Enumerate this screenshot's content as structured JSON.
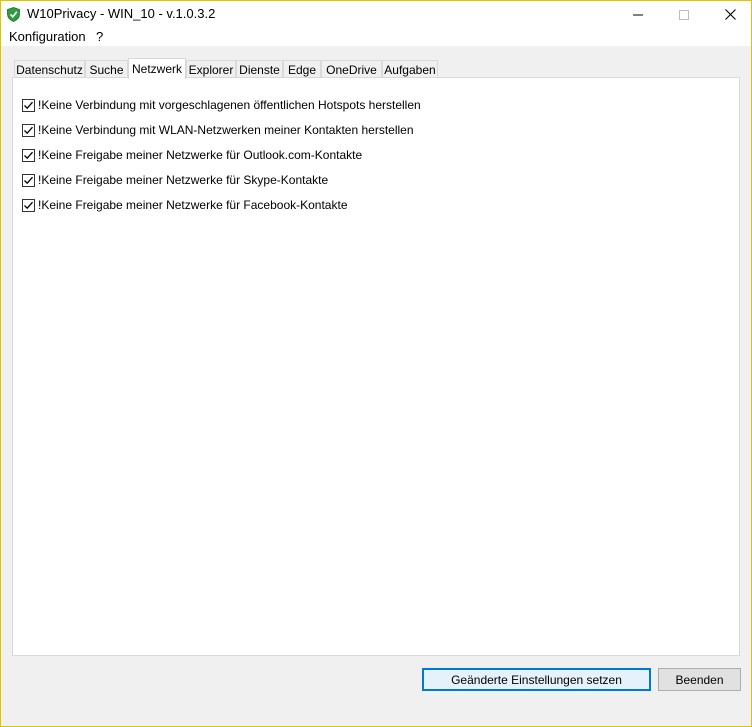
{
  "window": {
    "title": "W10Privacy - WIN_10 - v.1.0.3.2",
    "minimize_glyph": "—",
    "maximize_glyph": "☐",
    "close_glyph": "✕"
  },
  "menu": {
    "items": [
      "Konfiguration",
      "?"
    ]
  },
  "tabs": [
    {
      "label": "Datenschutz"
    },
    {
      "label": "Suche"
    },
    {
      "label": "Netzwerk",
      "active": true
    },
    {
      "label": "Explorer"
    },
    {
      "label": "Dienste"
    },
    {
      "label": "Edge"
    },
    {
      "label": "OneDrive"
    },
    {
      "label": "Aufgaben"
    }
  ],
  "settings": [
    {
      "label": "!Keine Verbindung mit vorgeschlagenen öffentlichen Hotspots herstellen",
      "checked": true
    },
    {
      "label": "!Keine Verbindung mit WLAN-Netzwerken meiner Kontakten herstellen",
      "checked": true
    },
    {
      "label": "!Keine Freigabe meiner Netzwerke für Outlook.com-Kontakte",
      "checked": true
    },
    {
      "label": "!Keine Freigabe meiner Netzwerke für Skype-Kontakte",
      "checked": true
    },
    {
      "label": "!Keine Freigabe meiner Netzwerke für Facebook-Kontakte",
      "checked": true
    }
  ],
  "buttons": {
    "apply": "Geänderte Einstellungen setzen",
    "quit": "Beenden"
  },
  "icons": {
    "app": "shield-check-icon",
    "check": "checkmark-icon"
  },
  "colors": {
    "app_icon_green": "#2e9e3e",
    "accent_border": "#0078d7"
  }
}
